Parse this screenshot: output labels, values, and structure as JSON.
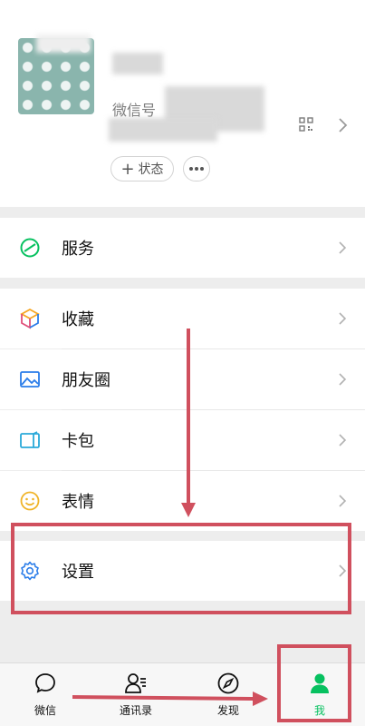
{
  "profile": {
    "wechat_id_label": "微信号",
    "qr_icon": "qrcode-icon",
    "status_button": {
      "plus": "+",
      "label": "状态"
    },
    "more_icon": "more-dots-icon"
  },
  "menu": {
    "services": {
      "label": "服务",
      "icon": "services-icon"
    },
    "favorites": {
      "label": "收藏",
      "icon": "favorites-icon"
    },
    "moments": {
      "label": "朋友圈",
      "icon": "moments-icon"
    },
    "cards": {
      "label": "卡包",
      "icon": "card-wallet-icon"
    },
    "stickers": {
      "label": "表情",
      "icon": "sticker-icon"
    },
    "settings": {
      "label": "设置",
      "icon": "gear-icon"
    }
  },
  "tabbar": {
    "tabs": [
      {
        "label": "微信",
        "icon": "chat-bubble-icon"
      },
      {
        "label": "通讯录",
        "icon": "contacts-icon"
      },
      {
        "label": "发现",
        "icon": "compass-icon"
      },
      {
        "label": "我",
        "icon": "person-icon",
        "active": true
      }
    ]
  },
  "colors": {
    "accent": "#07c160",
    "annotation": "#d0505e",
    "icon_blue": "#2b7de9"
  }
}
